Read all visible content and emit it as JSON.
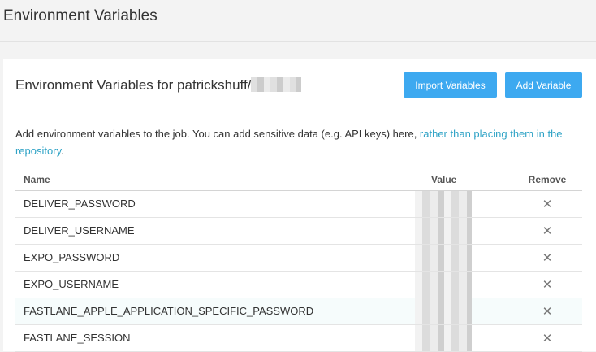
{
  "page": {
    "title": "Environment Variables"
  },
  "card": {
    "title_prefix": "Environment Variables for patrickshuff/",
    "import_label": "Import Variables",
    "add_label": "Add Variable",
    "description": "Add environment variables to the job. You can add sensitive data (e.g. API keys) here, ",
    "description_link": "rather than placing them in the repository",
    "description_end": "."
  },
  "table": {
    "headers": {
      "name": "Name",
      "value": "Value",
      "remove": "Remove"
    },
    "rows": [
      {
        "name": "DELIVER_PASSWORD"
      },
      {
        "name": "DELIVER_USERNAME"
      },
      {
        "name": "EXPO_PASSWORD"
      },
      {
        "name": "EXPO_USERNAME"
      },
      {
        "name": "FASTLANE_APPLE_APPLICATION_SPECIFIC_PASSWORD"
      },
      {
        "name": "FASTLANE_SESSION"
      }
    ],
    "remove_glyph": "✕"
  }
}
